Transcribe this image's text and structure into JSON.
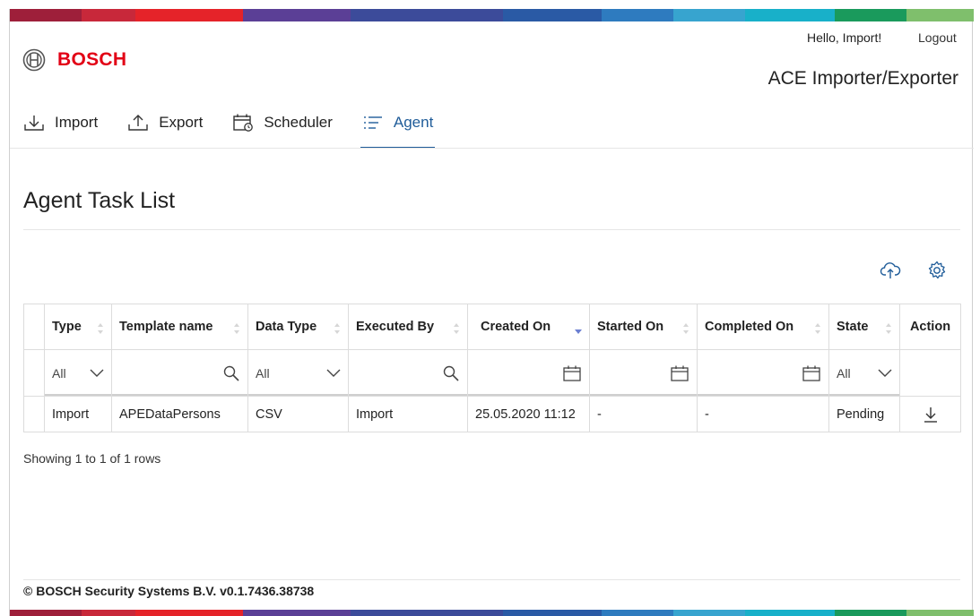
{
  "colors": {
    "brand_red": "#e20015",
    "accent_blue": "#1f5c99",
    "stripe": [
      "#9e1f3a",
      "#c8283a",
      "#e52329",
      "#5b3f96",
      "#3c4b9a",
      "#2a5aa5",
      "#2e7bbf",
      "#37a4cf",
      "#18b0c9",
      "#1a9a5c",
      "#7fbf6c",
      "#4db05a"
    ]
  },
  "header": {
    "brand": "BOSCH",
    "greeting": "Hello, Import!",
    "logout": "Logout",
    "app_title": "ACE Importer/Exporter"
  },
  "nav": {
    "items": [
      {
        "label": "Import",
        "icon": "import-icon",
        "active": false
      },
      {
        "label": "Export",
        "icon": "export-icon",
        "active": false
      },
      {
        "label": "Scheduler",
        "icon": "calendar-clock-icon",
        "active": false
      },
      {
        "label": "Agent",
        "icon": "list-icon",
        "active": true
      }
    ]
  },
  "page": {
    "title": "Agent Task List"
  },
  "toolbar": {
    "icons": [
      "cloud-upload-icon",
      "gear-icon"
    ]
  },
  "table": {
    "columns": [
      {
        "label": "Type",
        "sort": "none",
        "filter": "select"
      },
      {
        "label": "Template name",
        "sort": "none",
        "filter": "search"
      },
      {
        "label": "Data Type",
        "sort": "none",
        "filter": "select"
      },
      {
        "label": "Executed By",
        "sort": "none",
        "filter": "search"
      },
      {
        "label": "Created On",
        "sort": "desc",
        "filter": "date"
      },
      {
        "label": "Started On",
        "sort": "none",
        "filter": "date"
      },
      {
        "label": "Completed On",
        "sort": "none",
        "filter": "date"
      },
      {
        "label": "State",
        "sort": "none",
        "filter": "select"
      },
      {
        "label": "Action",
        "sort": null,
        "filter": null
      }
    ],
    "filters": {
      "type": "All",
      "data_type": "All",
      "state": "All"
    },
    "rows": [
      {
        "type": "Import",
        "template_name": "APEDataPersons",
        "data_type": "CSV",
        "executed_by": "Import",
        "created_on": "25.05.2020 11:12",
        "started_on": "-",
        "completed_on": "-",
        "state": "Pending",
        "action_icon": "download-icon"
      }
    ]
  },
  "pagination": {
    "info": "Showing 1 to 1 of 1 rows"
  },
  "footer": {
    "copyright": "© BOSCH Security Systems B.V. v0.1.7436.38738"
  }
}
